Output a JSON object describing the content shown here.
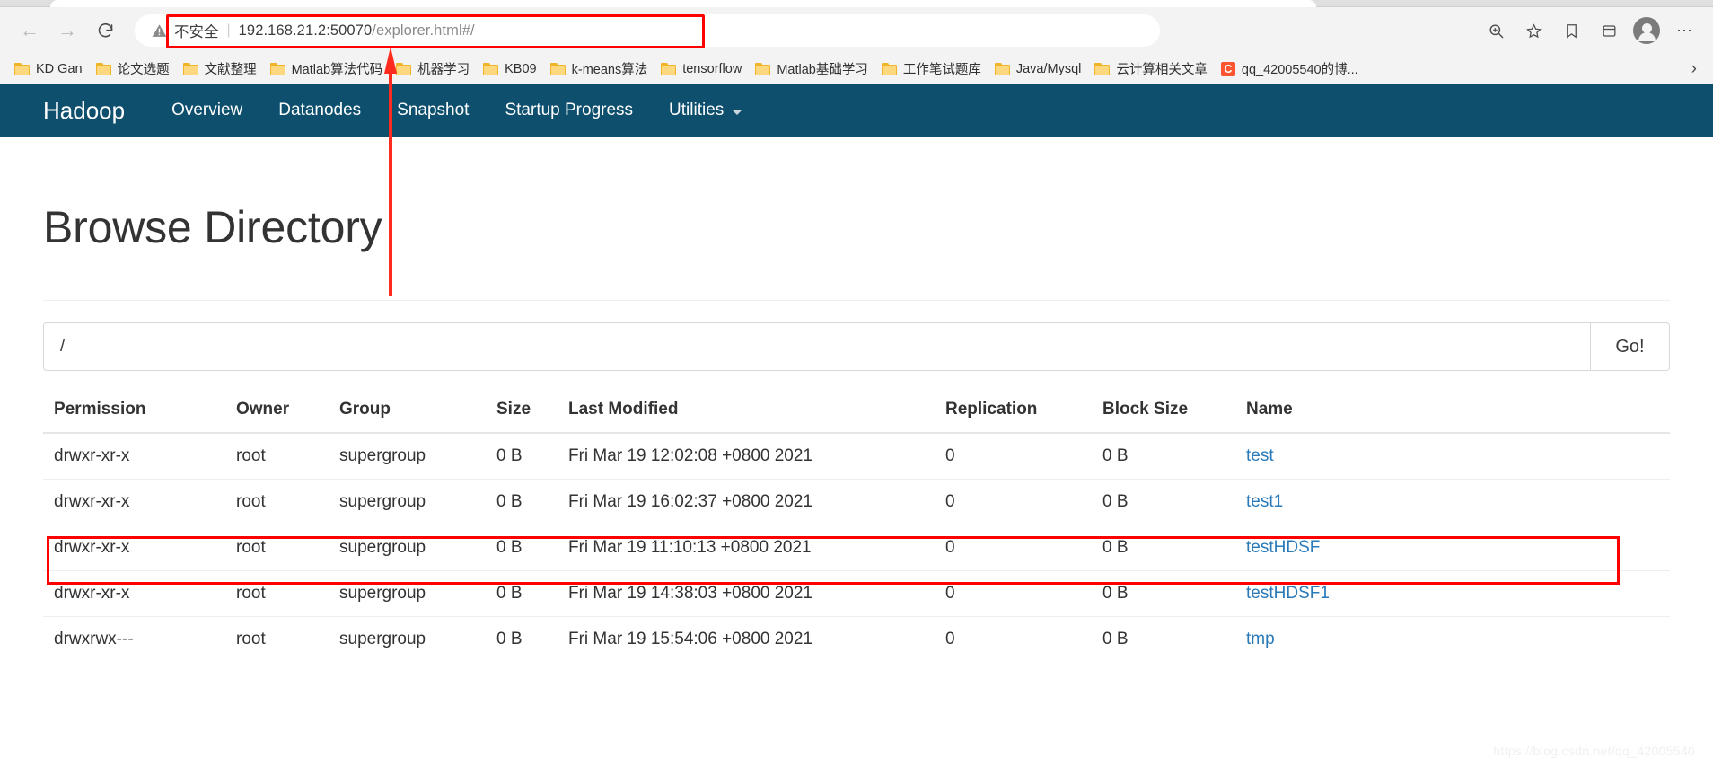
{
  "browser": {
    "back_icon": "back-arrow-icon",
    "forward_icon": "forward-arrow-icon",
    "reload_icon": "reload-icon",
    "security_label": "不安全",
    "separator": "|",
    "url_host": "192.168.21.2:50070",
    "url_path": "/explorer.html#/",
    "url_full": "192.168.21.2:50070/explorer.html#/",
    "zoom_icon": "zoom-icon",
    "favorite_icon": "star-icon",
    "collections_icon": "collections-icon",
    "favorites_bar_icon": "favorites-icon",
    "profile_icon": "profile-avatar-icon",
    "settings_icon": "more-options-icon",
    "overflow_chevron": "chevron-right-icon"
  },
  "bookmarks": {
    "items": [
      {
        "label": "KD Gan",
        "icon": "folder-icon"
      },
      {
        "label": "论文选题",
        "icon": "folder-icon"
      },
      {
        "label": "文献整理",
        "icon": "folder-icon"
      },
      {
        "label": "Matlab算法代码",
        "icon": "folder-icon"
      },
      {
        "label": "机器学习",
        "icon": "folder-icon"
      },
      {
        "label": "KB09",
        "icon": "folder-icon"
      },
      {
        "label": "k-means算法",
        "icon": "folder-icon"
      },
      {
        "label": "tensorflow",
        "icon": "folder-icon"
      },
      {
        "label": "Matlab基础学习",
        "icon": "folder-icon"
      },
      {
        "label": "工作笔试题库",
        "icon": "folder-icon"
      },
      {
        "label": "Java/Mysql",
        "icon": "folder-icon"
      },
      {
        "label": "云计算相关文章",
        "icon": "folder-icon"
      },
      {
        "label": "qq_42005540的博...",
        "icon": "csdn-icon"
      }
    ]
  },
  "hadoop_nav": {
    "brand": "Hadoop",
    "bar_color": "#0e4f6e",
    "links": [
      {
        "label": "Overview"
      },
      {
        "label": "Datanodes"
      },
      {
        "label": "Snapshot"
      },
      {
        "label": "Startup Progress"
      },
      {
        "label": "Utilities",
        "has_caret": true
      }
    ]
  },
  "page": {
    "title": "Browse Directory",
    "path_value": "/",
    "path_placeholder": "/",
    "go_label": "Go!",
    "watermark": "https://blog.csdn.net/qq_42005540"
  },
  "table": {
    "headers": [
      "Permission",
      "Owner",
      "Group",
      "Size",
      "Last Modified",
      "Replication",
      "Block Size",
      "Name"
    ],
    "rows": [
      {
        "permission": "drwxr-xr-x",
        "owner": "root",
        "group": "supergroup",
        "size": "0 B",
        "last_modified": "Fri Mar 19 12:02:08 +0800 2021",
        "replication": "0",
        "block_size": "0 B",
        "name": "test",
        "highlighted": false
      },
      {
        "permission": "drwxr-xr-x",
        "owner": "root",
        "group": "supergroup",
        "size": "0 B",
        "last_modified": "Fri Mar 19 16:02:37 +0800 2021",
        "replication": "0",
        "block_size": "0 B",
        "name": "test1",
        "highlighted": true
      },
      {
        "permission": "drwxr-xr-x",
        "owner": "root",
        "group": "supergroup",
        "size": "0 B",
        "last_modified": "Fri Mar 19 11:10:13 +0800 2021",
        "replication": "0",
        "block_size": "0 B",
        "name": "testHDSF",
        "highlighted": false
      },
      {
        "permission": "drwxr-xr-x",
        "owner": "root",
        "group": "supergroup",
        "size": "0 B",
        "last_modified": "Fri Mar 19 14:38:03 +0800 2021",
        "replication": "0",
        "block_size": "0 B",
        "name": "testHDSF1",
        "highlighted": false
      },
      {
        "permission": "drwxrwx---",
        "owner": "root",
        "group": "supergroup",
        "size": "0 B",
        "last_modified": "Fri Mar 19 15:54:06 +0800 2021",
        "replication": "0",
        "block_size": "0 B",
        "name": "tmp",
        "highlighted": false
      }
    ]
  },
  "annotations": {
    "color": "#ff0000",
    "url_box": "highlights the address bar url",
    "arrow": "red arrow pointing from page up to the url",
    "row_box": "highlights the test1 directory row"
  }
}
